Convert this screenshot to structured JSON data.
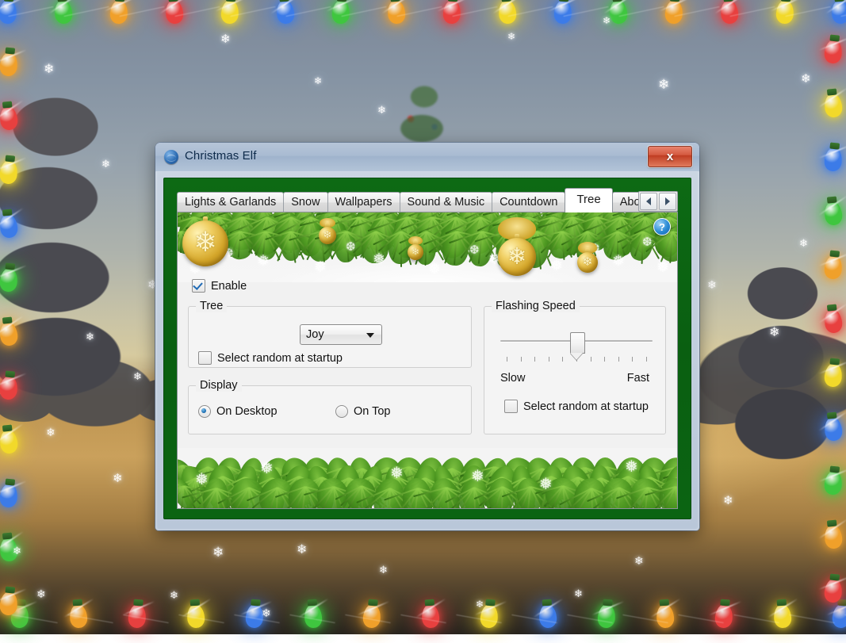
{
  "window": {
    "title": "Christmas Elf",
    "icon": "globe-icon",
    "close_label": "x"
  },
  "tabs": {
    "items": [
      {
        "label": "Lights & Garlands",
        "active": false
      },
      {
        "label": "Snow",
        "active": false
      },
      {
        "label": "Wallpapers",
        "active": false
      },
      {
        "label": "Sound & Music",
        "active": false
      },
      {
        "label": "Countdown",
        "active": false
      },
      {
        "label": "Tree",
        "active": true
      },
      {
        "label": "About",
        "active": false
      }
    ],
    "scroll_prev": "◀",
    "scroll_next": "▶"
  },
  "page": {
    "help_label": "?",
    "enable": {
      "label": "Enable",
      "checked": true
    },
    "tree_group": {
      "title": "Tree",
      "combo_value": "Joy",
      "combo_options": [
        "Joy"
      ],
      "random_startup": {
        "label": "Select random at startup",
        "checked": false
      }
    },
    "display_group": {
      "title": "Display",
      "options": [
        {
          "label": "On Desktop",
          "selected": true
        },
        {
          "label": "On Top",
          "selected": false
        }
      ]
    },
    "flashing_group": {
      "title": "Flashing Speed",
      "min_label": "Slow",
      "max_label": "Fast",
      "tick_count": 11,
      "value_index": 5,
      "random_startup": {
        "label": "Select random at startup",
        "checked": false
      }
    }
  },
  "desktop": {
    "theme": "winter-twilight-snow-scene",
    "light_colors": [
      "#3c7be8",
      "#3fc63f",
      "#f0a02a",
      "#e8403f",
      "#f2d92a"
    ],
    "accent": "#0b6412"
  }
}
